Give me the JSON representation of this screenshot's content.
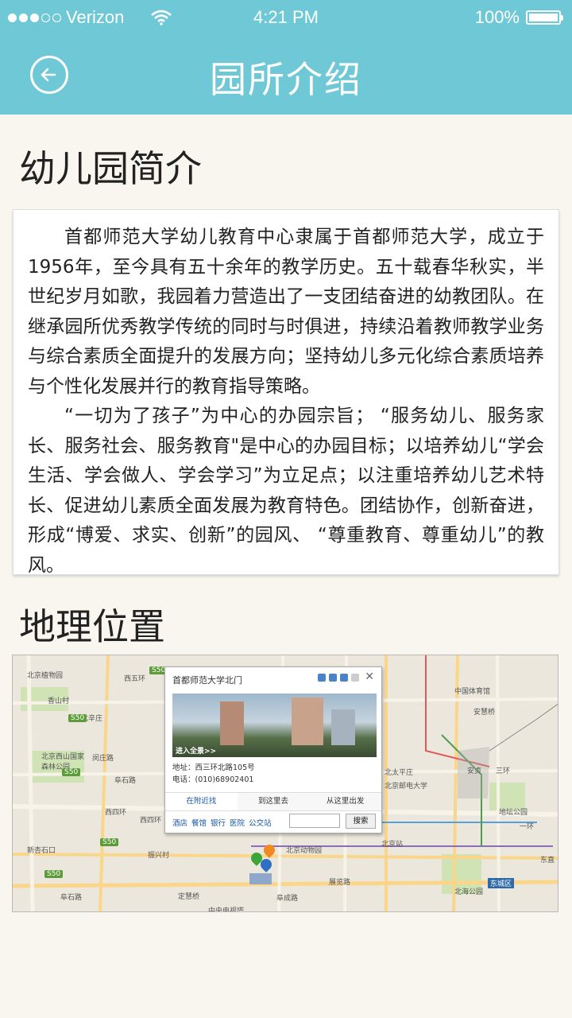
{
  "status_bar": {
    "carrier": "Verizon",
    "time": "4:21 PM",
    "battery": "100%",
    "battery_level": 1.0,
    "signal_bars": 3
  },
  "header": {
    "title": "园所介绍"
  },
  "intro": {
    "heading": "幼儿园简介",
    "paragraphs": [
      "首都师范大学幼儿教育中心隶属于首都师范大学，成立于1956年，至今具有五十余年的教学历史。五十载春华秋实，半世纪岁月如歌，我园着力营造出了一支团结奋进的幼教团队。在继承园所优秀教学传统的同时与时俱进，持续沿着教师教学业务与综合素质全面提升的发展方向；坚持幼儿多元化综合素质培养与个性化发展并行的教育指导策略。",
      "“一切为了孩子”为中心的办园宗旨； “服务幼儿、服务家长、服务社会、服务教育\"是中心的办园目标；以培养幼儿“学会生活、学会做人、学会学习”为立足点；以注重培养幼儿艺术特长、促进幼儿素质全面发展为教育特色。团结协作，创新奋进，形成“博爱、求实、创新”的园风、 “尊重教育、尊重幼儿”的教风。"
    ]
  },
  "location": {
    "heading": "地理位置",
    "map": {
      "labels": [
        "北京植物园",
        "香山村",
        "北辛庄",
        "北京西山国家森林公园",
        "闵庄路",
        "阜石路",
        "西四环",
        "西四环",
        "西五环",
        "振兴村",
        "新杏石口",
        "阜石路",
        "定慧桥",
        "中央电视塔",
        "阜成路",
        "展览路",
        "北京动物园",
        "北太平庄",
        "北京邮电大学",
        "北京站",
        "中国体育馆",
        "安慧桥",
        "安贞",
        "三环",
        "地坛公园",
        "北海公园",
        "东直",
        "东城区",
        "一环"
      ],
      "road_tags": [
        "S50",
        "S50",
        "S50",
        "S50",
        "S50"
      ],
      "popup": {
        "title": "首都师范大学北门",
        "panorama_label": "进入全景>>",
        "address_label": "地址：",
        "address": "西三环北路105号",
        "phone_label": "电话：",
        "phone": "(010)68902401",
        "tabs": [
          "在附近找",
          "到这里去",
          "从这里出发"
        ],
        "links": [
          "酒店",
          "餐馆",
          "银行",
          "医院",
          "公交站"
        ],
        "search_button": "搜索",
        "close": "✕"
      }
    }
  },
  "colors": {
    "header_bg": "#6fc8d5",
    "page_bg": "#f8f6ef"
  }
}
